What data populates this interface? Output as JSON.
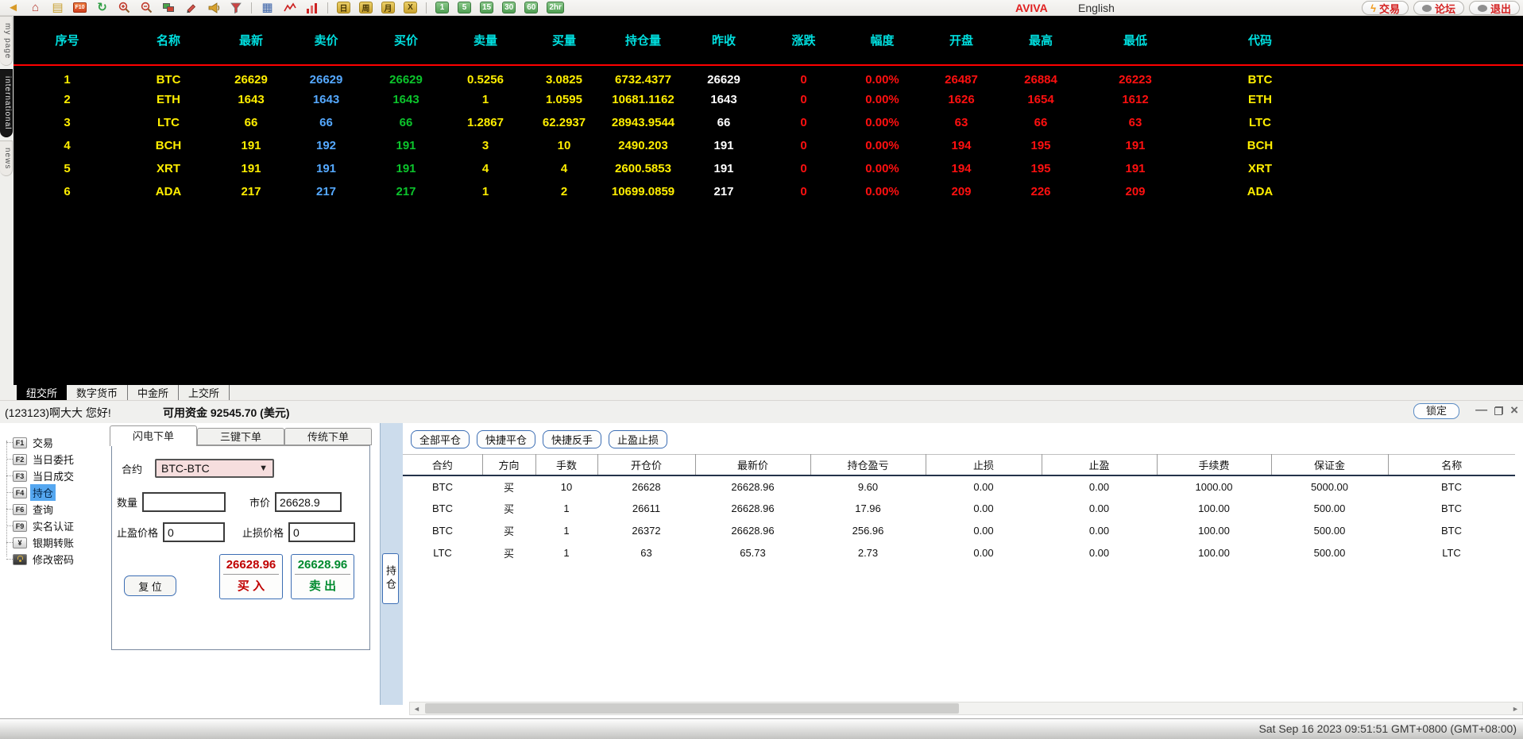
{
  "toolbar": {
    "icons": [
      "back",
      "home",
      "note",
      "f10",
      "refresh",
      "zoom-in",
      "zoom-out",
      "shapes",
      "pencil",
      "horn",
      "filter",
      "divider",
      "quote-table",
      "line-chart",
      "bar-chart",
      "divider"
    ],
    "period_yellow": [
      "日",
      "周",
      "月",
      "X"
    ],
    "period_green": [
      "1",
      "5",
      "15",
      "30",
      "60",
      "2hr"
    ],
    "brand": "AVIVA",
    "language": "English",
    "actions": [
      {
        "icon": "lightning",
        "label": "交易"
      },
      {
        "icon": "chat",
        "label": "论坛"
      },
      {
        "icon": "chat",
        "label": "退出"
      }
    ]
  },
  "side_tabs": [
    {
      "label": "my page",
      "active": false
    },
    {
      "label": "international",
      "active": true
    },
    {
      "label": "news",
      "active": false
    }
  ],
  "quote_table": {
    "columns": [
      "序号",
      "名称",
      "最新",
      "卖价",
      "买价",
      "卖量",
      "买量",
      "持仓量",
      "昨收",
      "涨跌",
      "幅度",
      "开盘",
      "最高",
      "最低",
      "代码"
    ],
    "rows": [
      [
        "1",
        "BTC",
        "26629",
        "26629",
        "26629",
        "0.5256",
        "3.0825",
        "6732.4377",
        "26629",
        "0",
        "0.00%",
        "26487",
        "26884",
        "26223",
        "BTC"
      ],
      [
        "2",
        "ETH",
        "1643",
        "1643",
        "1643",
        "1",
        "1.0595",
        "10681.1162",
        "1643",
        "0",
        "0.00%",
        "1626",
        "1654",
        "1612",
        "ETH"
      ],
      [
        "3",
        "LTC",
        "66",
        "66",
        "66",
        "1.2867",
        "62.2937",
        "28943.9544",
        "66",
        "0",
        "0.00%",
        "63",
        "66",
        "63",
        "LTC"
      ],
      [
        "4",
        "BCH",
        "191",
        "192",
        "191",
        "3",
        "10",
        "2490.203",
        "191",
        "0",
        "0.00%",
        "194",
        "195",
        "191",
        "BCH"
      ],
      [
        "5",
        "XRT",
        "191",
        "191",
        "191",
        "4",
        "4",
        "2600.5853",
        "191",
        "0",
        "0.00%",
        "194",
        "195",
        "191",
        "XRT"
      ],
      [
        "6",
        "ADA",
        "217",
        "217",
        "217",
        "1",
        "2",
        "10699.0859",
        "217",
        "0",
        "0.00%",
        "209",
        "226",
        "209",
        "ADA"
      ]
    ]
  },
  "exchange_tabs": [
    {
      "label": "纽交所",
      "active": true
    },
    {
      "label": "数字货币",
      "active": false
    },
    {
      "label": "中金所",
      "active": false
    },
    {
      "label": "上交所",
      "active": false
    }
  ],
  "account_bar": {
    "user": "(123123)啊大大 您好!",
    "funds": "可用资金 92545.70 (美元)",
    "lock_label": "锁定"
  },
  "left_menu": [
    {
      "badge": "F1",
      "label": "交易",
      "selected": false
    },
    {
      "badge": "F2",
      "label": "当日委托",
      "selected": false
    },
    {
      "badge": "F3",
      "label": "当日成交",
      "selected": false
    },
    {
      "badge": "F4",
      "label": "持仓",
      "selected": true
    },
    {
      "badge": "F6",
      "label": "查询",
      "selected": false
    },
    {
      "badge": "F9",
      "label": "实名认证",
      "selected": false
    },
    {
      "badge": "¥",
      "label": "银期转账",
      "selected": false
    },
    {
      "badge": "lock",
      "label": "修改密码",
      "selected": false
    }
  ],
  "order_panel": {
    "tabs": [
      {
        "label": "闪电下单",
        "active": true
      },
      {
        "label": "三键下单",
        "active": false
      },
      {
        "label": "传统下单",
        "active": false
      }
    ],
    "contract_label": "合约",
    "contract_value": "BTC-BTC",
    "qty_label": "数量",
    "qty_value": "",
    "price_label": "市价",
    "price_value": "26628.9",
    "tp_label": "止盈价格",
    "tp_value": "0",
    "sl_label": "止损价格",
    "sl_value": "0",
    "reset_label": "复 位",
    "buy": {
      "price": "26628.96",
      "label": "买 入"
    },
    "sell": {
      "price": "26628.96",
      "label": "卖 出"
    }
  },
  "position_side_tab": "持仓",
  "position_panel": {
    "buttons": [
      "全部平仓",
      "快捷平仓",
      "快捷反手",
      "止盈止损"
    ],
    "columns": [
      "合约",
      "方向",
      "手数",
      "开仓价",
      "最新价",
      "持仓盈亏",
      "止损",
      "止盈",
      "手续费",
      "保证金",
      "名称"
    ],
    "rows": [
      [
        "BTC",
        "买",
        "10",
        "26628",
        "26628.96",
        "9.60",
        "0.00",
        "0.00",
        "1000.00",
        "5000.00",
        "BTC"
      ],
      [
        "BTC",
        "买",
        "1",
        "26611",
        "26628.96",
        "17.96",
        "0.00",
        "0.00",
        "100.00",
        "500.00",
        "BTC"
      ],
      [
        "BTC",
        "买",
        "1",
        "26372",
        "26628.96",
        "256.96",
        "0.00",
        "0.00",
        "100.00",
        "500.00",
        "BTC"
      ],
      [
        "LTC",
        "买",
        "1",
        "63",
        "65.73",
        "2.73",
        "0.00",
        "0.00",
        "100.00",
        "500.00",
        "LTC"
      ]
    ]
  },
  "status_bar": {
    "datetime": "Sat Sep 16 2023 09:51:51 GMT+0800 (GMT+08:00)"
  },
  "colors": {
    "quote_yellow": "#ffee00",
    "quote_blue": "#55a9ff",
    "quote_green": "#0cc42c",
    "quote_red": "#ff1010",
    "header_cyan": "#00dfdf",
    "loss_red": "#e02020",
    "buy_red": "#c00000",
    "sell_green": "#008a2e",
    "brand_red": "#e02020"
  }
}
